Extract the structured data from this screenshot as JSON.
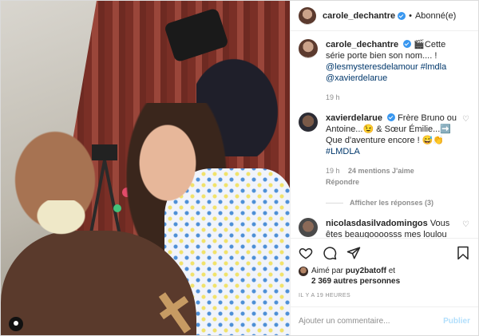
{
  "header": {
    "username": "carole_dechantre",
    "separator": "•",
    "follow_label": "Abonné(e)"
  },
  "caption": {
    "username": "carole_dechantre",
    "text_start": "🎬Cette série porte bien son nom.... !",
    "mention_1": "@lesmysteresdelamour",
    "hashtag_1": "#lmdla",
    "mention_2": "@xavierdelarue",
    "time": "19 h"
  },
  "comments": [
    {
      "username": "xavierdelarue",
      "text_start": "Frère Bruno ou Antoine...😉 & Sœur Émilie...➡️ Que d'aventure encore ! 😅👏",
      "hashtag": "#LMDLA",
      "time": "19 h",
      "likes": "24 mentions J'aime",
      "reply": "Répondre",
      "view_replies": "Afficher les réponses (3)"
    },
    {
      "username": "nicolasdasilvadomingos",
      "text": "Vous êtes beaugoooosss mes loulou 🖤✨"
    }
  ],
  "likes": {
    "prefix": "Aimé par",
    "user": "puy2batoff",
    "middle": "et",
    "others": "2 369 autres personnes"
  },
  "timestamp": "IL Y A 19 HEURES",
  "comment_box": {
    "placeholder": "Ajouter un commentaire...",
    "publish_label": "Publier"
  },
  "icons": {
    "like": "heart-icon",
    "comment": "comment-icon",
    "share": "share-icon",
    "save": "bookmark-icon",
    "tagged": "user-tag-icon",
    "verified": "verified-badge-icon"
  },
  "colors": {
    "link": "#00376b",
    "verified": "#3897f0",
    "muted": "#8e8e8e",
    "publish_disabled": "#b2dffc"
  }
}
